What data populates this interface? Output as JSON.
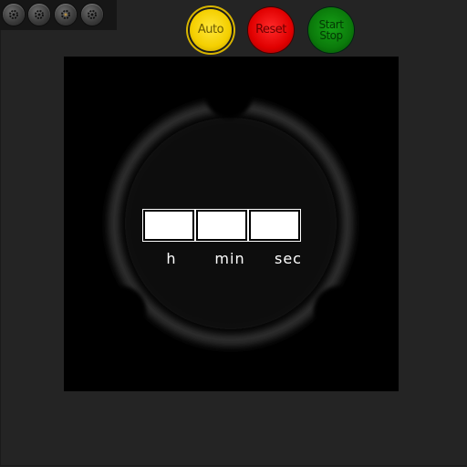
{
  "toolbar": {
    "buttons": [
      {
        "icon": "gear-icon"
      },
      {
        "icon": "gear-icon"
      },
      {
        "icon": "gear-icon"
      },
      {
        "icon": "gear-icon"
      }
    ]
  },
  "controls": {
    "auto_label": "Auto",
    "reset_label": "Reset",
    "start_label_line1": "Start",
    "start_label_line2": "Stop",
    "auto_color": "#f4cf00",
    "reset_color": "#e00000",
    "start_color": "#0b7a0b"
  },
  "timer": {
    "hours_value": "",
    "minutes_value": "",
    "seconds_value": "",
    "hours_label": "h",
    "minutes_label": "min",
    "seconds_label": "sec"
  }
}
